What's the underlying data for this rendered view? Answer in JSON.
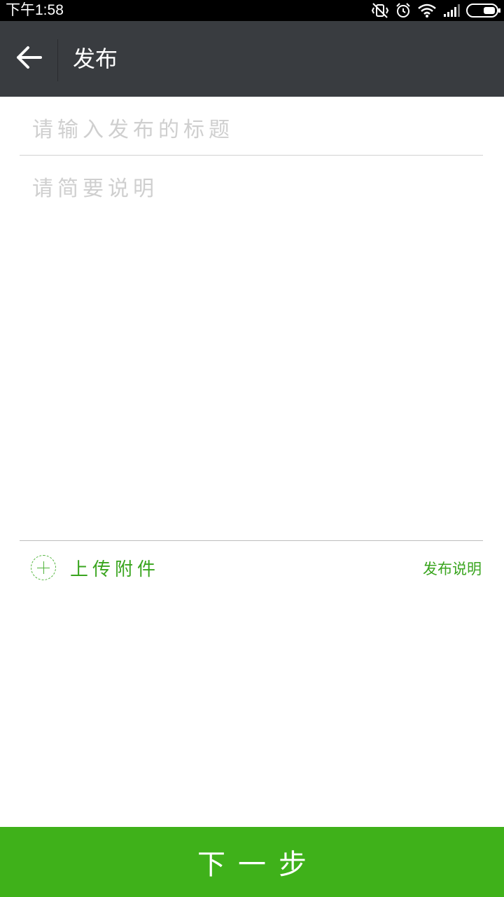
{
  "status_bar": {
    "time": "下午1:58",
    "icons": [
      "vibrate-off-icon",
      "alarm-icon",
      "wifi-icon",
      "signal-icon",
      "battery-icon"
    ]
  },
  "header": {
    "title": "发布",
    "back_icon": "arrow-left-icon"
  },
  "form": {
    "title_placeholder": "请输入发布的标题",
    "title_value": "",
    "description_placeholder": "请简要说明",
    "description_value": ""
  },
  "attachment": {
    "upload_label": "上传附件",
    "upload_icon": "plus-circle-icon",
    "publish_note_label": "发布说明"
  },
  "footer": {
    "next_label": "下一步"
  },
  "colors": {
    "status_bar_bg": "#000000",
    "title_bar_bg": "#393c40",
    "accent_green": "#3fb11a",
    "link_green": "#3aa51f",
    "placeholder_gray": "#cfcfcf"
  }
}
